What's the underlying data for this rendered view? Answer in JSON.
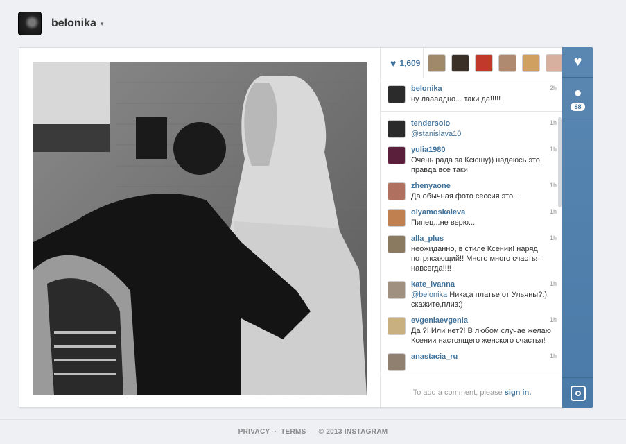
{
  "header": {
    "username": "belonika",
    "caret": "▾"
  },
  "post": {
    "likes_count": "1,609",
    "caption": {
      "user": "belonika",
      "text": "ну лаааадно... таки да!!!!!",
      "time": "2h"
    },
    "comments": [
      {
        "user": "tendersolo",
        "text": "@stanislava10",
        "time": "1h",
        "color": "#2b2b2b"
      },
      {
        "user": "yulia1980",
        "text": "Очень рада за Ксюшу)) надеюсь это правда все таки",
        "time": "1h",
        "color": "#5a1f3a"
      },
      {
        "user": "zhenyaone",
        "text": "Да обычная фото сессия это..",
        "time": "1h",
        "color": "#b07060"
      },
      {
        "user": "olyamoskaleva",
        "text": "Пипец...не верю...",
        "time": "1h",
        "color": "#c08050"
      },
      {
        "user": "alla_plus",
        "text": "неожиданно, в стиле Ксении! наряд потрясающий!! Много много счастья навсегда!!!!",
        "time": "1h",
        "color": "#8a7a60"
      },
      {
        "user": "kate_ivanna",
        "mention": "@belonika",
        "text": " Ника,а платье от Ульяны?:) скажите,плиз:)",
        "time": "1h",
        "color": "#a09080"
      },
      {
        "user": "evgeniaevgenia",
        "text": "Да ?! Или нет?! В любом случае желаю Ксении настоящего женского счастья!",
        "time": "1h",
        "color": "#c8b080"
      },
      {
        "user": "anastacia_ru",
        "text": "",
        "time": "1h",
        "color": "#908070"
      }
    ],
    "liker_colors": [
      "#a0886a",
      "#3a3028",
      "#c0392b",
      "#b08a70",
      "#d0a060",
      "#d8b0a0"
    ],
    "add_comment_text": "To add a comment, please",
    "add_comment_link": "sign in.",
    "comment_count": "88"
  },
  "footer": {
    "privacy": "PRIVACY",
    "terms": "TERMS",
    "copyright": "© 2013 INSTAGRAM",
    "sep": "·"
  },
  "colors": {
    "accent": "#3f729b",
    "sidebar": "#4f7fad"
  }
}
